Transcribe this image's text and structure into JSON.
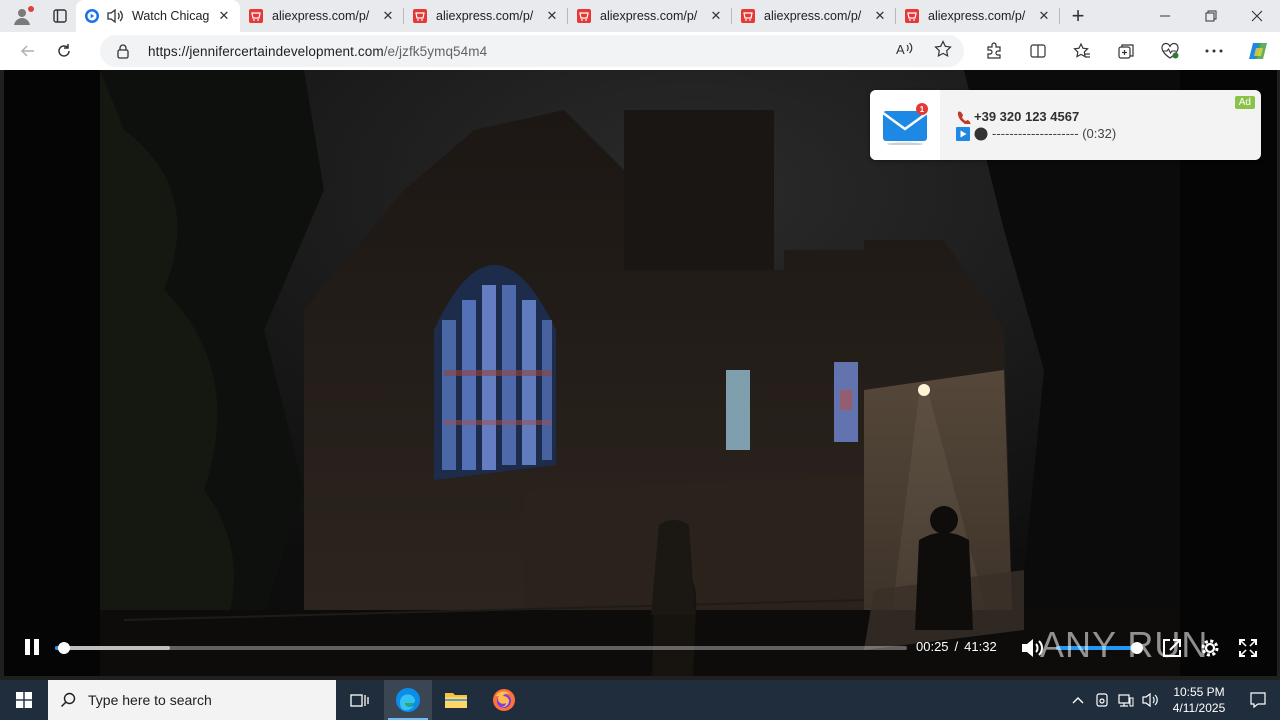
{
  "browser": {
    "tabs": [
      {
        "title": "Watch Chicag",
        "favicon": "play-circle-icon",
        "audio": true,
        "active": true
      },
      {
        "title": "aliexpress.com/p/",
        "favicon": "aliexpress-cart-icon",
        "active": false
      },
      {
        "title": "aliexpress.com/p/",
        "favicon": "aliexpress-cart-icon",
        "active": false
      },
      {
        "title": "aliexpress.com/p/",
        "favicon": "aliexpress-cart-icon",
        "active": false
      },
      {
        "title": "aliexpress.com/p/",
        "favicon": "aliexpress-cart-icon",
        "active": false
      },
      {
        "title": "aliexpress.com/p/",
        "favicon": "aliexpress-cart-icon",
        "active": false
      }
    ],
    "url_host": "https://jennifercertaindevelopment.com",
    "url_path": "/e/jzfk5ymq54m4"
  },
  "ad": {
    "phone": "+39 320 123 4567",
    "subline": "-------------------- (0:32)",
    "tag": "Ad",
    "badge_count": "1"
  },
  "player": {
    "current_time": "00:25",
    "separator": "/",
    "duration": "41:32",
    "progress_fraction": 0.01,
    "buffered_fraction": 0.135,
    "volume_fraction": 0.97,
    "state": "playing"
  },
  "watermark": "ANY RUN",
  "taskbar": {
    "search_placeholder": "Type here to search",
    "time": "10:55 PM",
    "date": "4/11/2025"
  },
  "colors": {
    "accent": "#2196f3",
    "taskbar": "#1f2d3d",
    "tab_favicon_red": "#e53935"
  }
}
